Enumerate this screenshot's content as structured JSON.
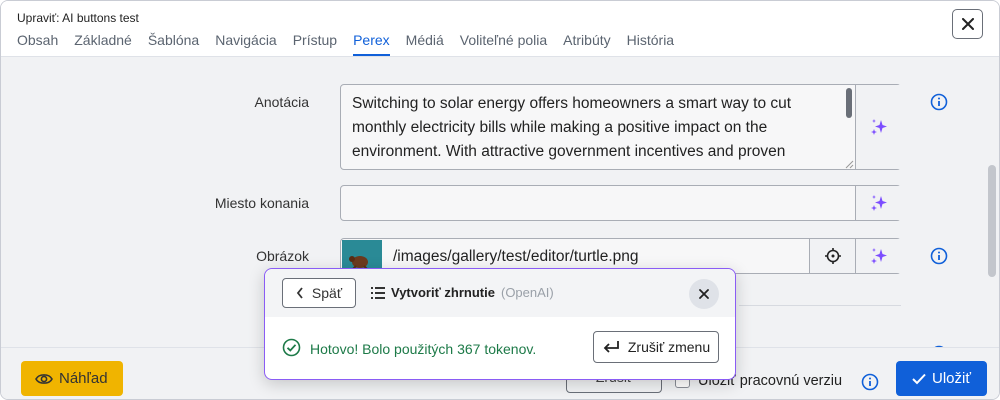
{
  "window": {
    "title": "Upraviť: AI buttons test"
  },
  "tabs": [
    {
      "label": "Obsah"
    },
    {
      "label": "Základné"
    },
    {
      "label": "Šablóna"
    },
    {
      "label": "Navigácia"
    },
    {
      "label": "Prístup"
    },
    {
      "label": "Perex"
    },
    {
      "label": "Médiá"
    },
    {
      "label": "Voliteľné polia"
    },
    {
      "label": "Atribúty"
    },
    {
      "label": "História"
    }
  ],
  "active_tab": "Perex",
  "form": {
    "annotation_label": "Anotácia",
    "annotation_value": "Switching to solar energy offers homeowners a smart way to cut monthly electricity bills while making a positive impact on the environment. With attractive government incentives and proven",
    "venue_label": "Miesto konania",
    "venue_value": "",
    "image_label": "Obrázok",
    "image_path": "/images/gallery/test/editor/turtle.png"
  },
  "footer": {
    "preview_label": "Náhľad",
    "cancel_label": "Zrušiť",
    "save_draft_label": "Uložiť pracovnú verziu",
    "save_label": "Uložiť"
  },
  "popup": {
    "back_label": "Späť",
    "title": "Vytvoriť zhrnutie",
    "provider": "(OpenAI)",
    "status_text": "Hotovo! Bolo použitých 367 tokenov.",
    "undo_label": "Zrušiť zmenu"
  },
  "colors": {
    "accent": "#1060d9",
    "ai_purple": "#7c4dff",
    "success": "#1d7a48",
    "preview_yellow": "#f0b400"
  }
}
